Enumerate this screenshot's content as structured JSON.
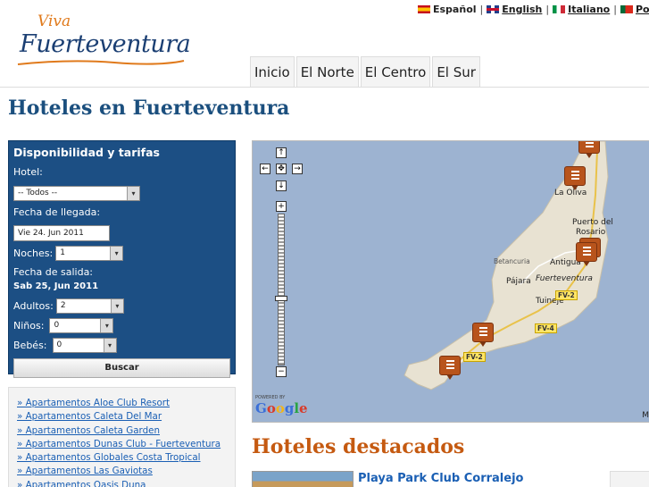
{
  "languages": [
    {
      "label": "Español",
      "flag": "spain-flag-icon",
      "active": true
    },
    {
      "label": "English",
      "flag": "uk-flag-icon",
      "active": false
    },
    {
      "label": "Italiano",
      "flag": "italy-flag-icon",
      "active": false
    },
    {
      "label": "Por",
      "flag": "portugal-flag-icon",
      "active": false
    }
  ],
  "logo": {
    "line1": "Viva",
    "line2": "Fuerteventura"
  },
  "nav": [
    {
      "label": "Inicio"
    },
    {
      "label": "El Norte"
    },
    {
      "label": "El Centro"
    },
    {
      "label": "El Sur"
    }
  ],
  "page_title": "Hoteles en Fuerteventura",
  "booking": {
    "title": "Disponibilidad y tarifas",
    "hotel_label": "Hotel:",
    "hotel_value": "-- Todos --",
    "arrival_label": "Fecha de llegada:",
    "arrival_value": "Vie 24. Jun 2011",
    "nights_label": "Noches:",
    "nights_value": "1",
    "departure_label": "Fecha de salida:",
    "departure_value": "Sab 25, Jun 2011",
    "adults_label": "Adultos:",
    "adults_value": "2",
    "children_label": "Niños:",
    "children_value": "0",
    "babies_label": "Bebés:",
    "babies_value": "0",
    "search_label": "Buscar"
  },
  "hotel_list": [
    "» Apartamentos Aloe Club Resort",
    "» Apartamentos Caleta Del Mar",
    "» Apartamentos Caleta Garden",
    "» Apartamentos Dunas Club - Fuerteventura",
    "» Apartamentos Globales Costa Tropical",
    "» Apartamentos Las Gaviotas",
    "» Apartamentos Oasis Duna"
  ],
  "map": {
    "places": {
      "la_oliva": "La Oliva",
      "puerto_del": "Puerto del",
      "rosario": "Rosario",
      "betancuria": "Betancuria",
      "antigua": "Antigua",
      "fuerteventura": "Fuerteventura",
      "pajara": "Pájara",
      "tuineje": "Tuineje"
    },
    "roads": {
      "fv2a": "FV-2",
      "fv4": "FV-4",
      "fv2b": "FV-2"
    },
    "controls": {
      "up": "↑",
      "left": "←",
      "center": "✥",
      "right": "→",
      "down": "↓",
      "zoom_in": "+",
      "zoom_out": "−"
    },
    "powered": "POWERED BY",
    "google": "Google",
    "corner": "M"
  },
  "featured": {
    "title": "Hoteles destacados",
    "hotel_name": "Playa Park Club Corralejo"
  }
}
